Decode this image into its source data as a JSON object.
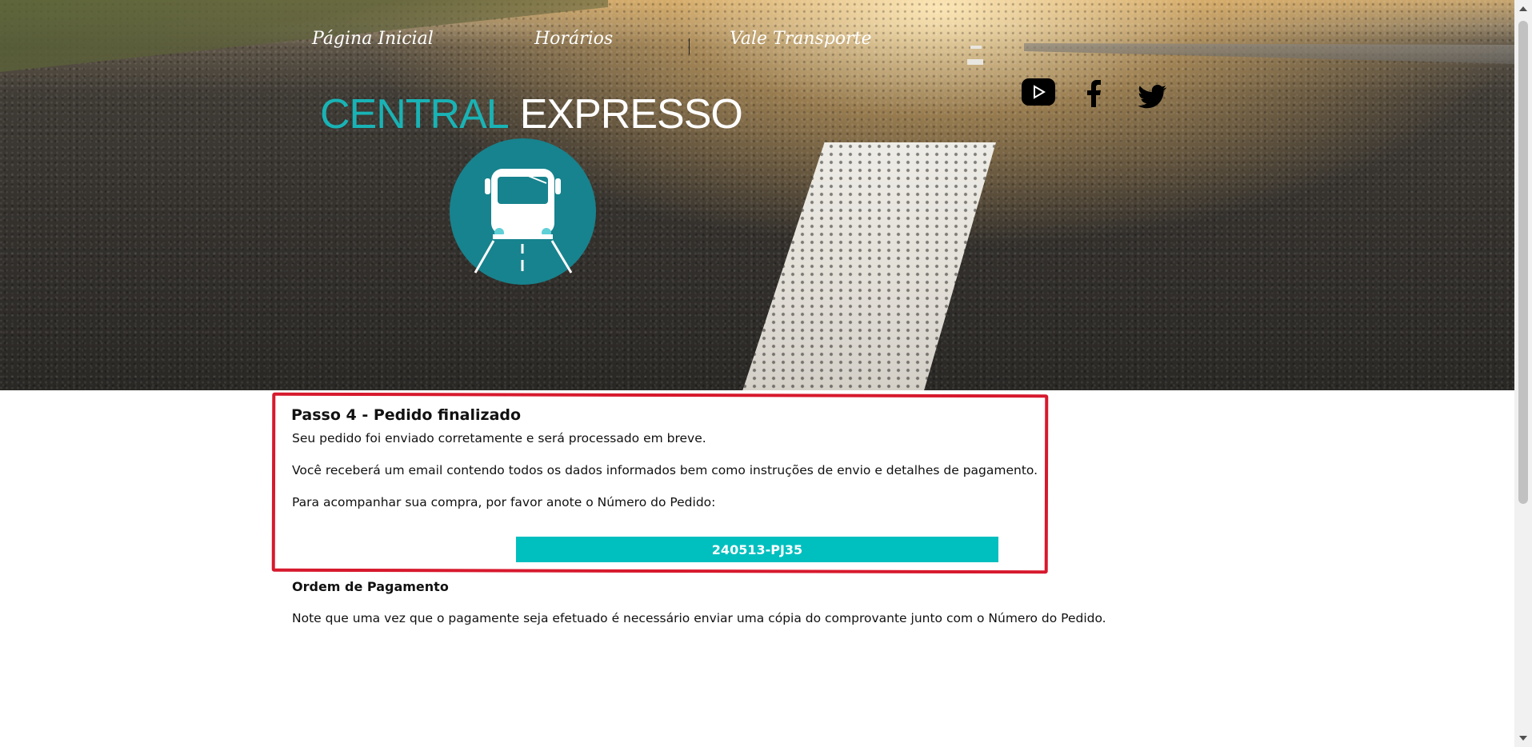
{
  "nav": {
    "items": [
      {
        "label": "Página Inicial"
      },
      {
        "label": "Horários"
      },
      {
        "label": "Vale Transporte"
      }
    ]
  },
  "logo": {
    "word1": "CENTRAL",
    "word2": "EXPRESSO",
    "color1": "#19b3b5",
    "color2": "#ffffff",
    "icon": "bus-icon",
    "icon_bg": "#17838e"
  },
  "social": [
    {
      "icon": "youtube-icon"
    },
    {
      "icon": "facebook-icon"
    },
    {
      "icon": "twitter-icon"
    }
  ],
  "order": {
    "step_title": "Passo 4 - Pedido finalizado",
    "line1": "Seu pedido foi enviado corretamente e será processado em breve.",
    "line2": "Você receberá um email contendo todos os dados informados bem como instruções de envio e detalhes de pagamento.",
    "line3": "Para acompanhar sua compra, por favor anote o Número do Pedido:",
    "order_number": "240513-PJ35",
    "order_bar_color": "#00bfbf",
    "highlight_color": "#d7192d"
  },
  "payment": {
    "title": "Ordem de Pagamento",
    "note": "Note que uma vez que o pagamente seja efetuado é necessário enviar uma cópia do comprovante junto com o Número do Pedido."
  }
}
